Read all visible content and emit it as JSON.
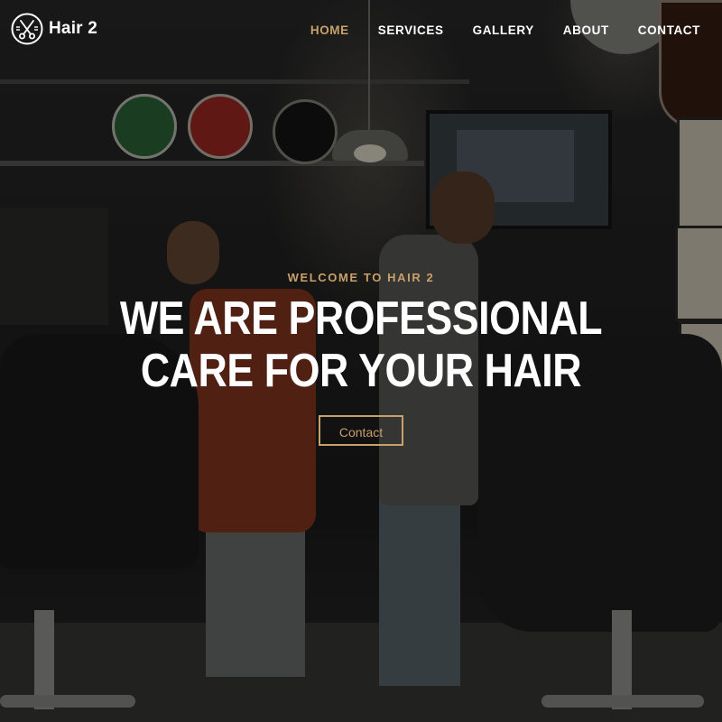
{
  "brand": {
    "logo_icon": "scissors-comb-icon",
    "name": "Hair 2"
  },
  "nav": {
    "items": [
      {
        "label": "HOME",
        "active": true
      },
      {
        "label": "SERVICES",
        "active": false
      },
      {
        "label": "GALLERY",
        "active": false
      },
      {
        "label": "ABOUT",
        "active": false
      },
      {
        "label": "CONTACT",
        "active": false
      }
    ]
  },
  "hero": {
    "eyebrow": "WELCOME TO HAIR 2",
    "headline": "WE ARE PROFESSIONAL CARE FOR YOUR HAIR",
    "cta_label": "Contact",
    "background": "barbershop-photo"
  },
  "colors": {
    "accent": "#c9a06a",
    "text": "#ffffff",
    "overlay": "rgba(0,0,0,0.42)"
  }
}
